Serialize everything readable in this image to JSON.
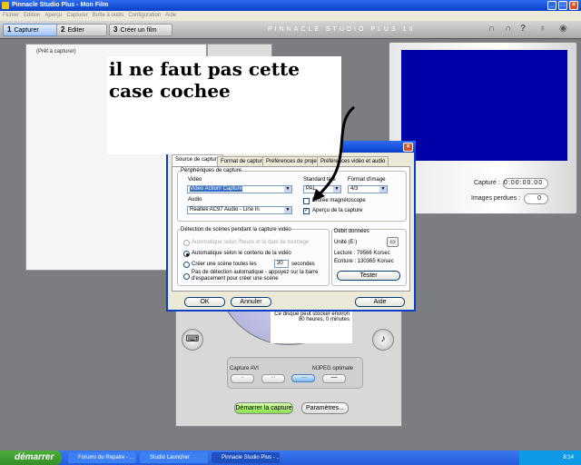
{
  "window": {
    "title": "Pinnacle Studio Plus - Mon Film"
  },
  "menu": [
    "Fichier",
    "Edition",
    "Aperçu",
    "Capturer",
    "Boîte à outils",
    "Configuration",
    "Aide"
  ],
  "tabs": [
    {
      "num": "1",
      "label": "Capturer"
    },
    {
      "num": "2",
      "label": "Editer"
    },
    {
      "num": "3",
      "label": "Créer un film"
    }
  ],
  "brand": "PINNACLE STUDIO PLUS 10",
  "album": {
    "status": "(Prêt à capturer)"
  },
  "preview": {
    "captured_label": "Capturé :",
    "captured_value": "0:00:00.00",
    "lost_label": "Images perdues :",
    "lost_value": "0"
  },
  "annotation": "il ne faut pas cette case cochee",
  "dialog": {
    "tabs": [
      "Source de capture",
      "Format de capture",
      "Préférences de projet",
      "Préférences vidéo et audio"
    ],
    "devices_group": "Périphériques de capture",
    "video_label": "Vidéo",
    "video_value": "Video Action! Capture",
    "audio_label": "Audio",
    "audio_value": "Realtek AC97 Audio - Line In",
    "tv_label": "Standard télé",
    "tv_value": "PAL",
    "format_label": "Format d'image",
    "format_value": "4/3",
    "vcr_label": "Entrée magnétoscope",
    "vcr_checked": false,
    "preview_label": "Aperçu de la capture",
    "preview_checked": true,
    "scene_group": "Détection de scènes pendant la capture vidéo",
    "scene_opt1": "Automatique selon l'heure et la date de tournage",
    "scene_opt2": "Automatique selon le contenu de la vidéo",
    "scene_opt3": "Créer une scène toutes les",
    "scene_seconds": "30",
    "seconds_label": "secondes",
    "scene_opt4": "Pas de détection automatique - appuyez sur la barre d'espacement pour créer une scène",
    "rate_group": "Débit données",
    "drive": "Unité (E:)",
    "read": "Lecture : 79566 Ko/sec",
    "write": "Ecriture : 130365 Ko/sec",
    "test": "Tester",
    "ok": "OK",
    "cancel": "Annuler",
    "help": "Aide"
  },
  "capture": {
    "disk_text1": "Ce disque peut stocker environ",
    "disk_text2": "80 heures, 0 minutes",
    "quality_left": "Capture AVI",
    "quality_right": "MJPEG optimale",
    "start": "Démarrer la capture",
    "params": "Paramètres..."
  },
  "taskbar": {
    "start": "démarrer",
    "tasks": [
      "Forums du Repaire - ...",
      "Studio Launcher",
      "Pinnacle Studio Plus - ..."
    ],
    "clock": "8:14"
  }
}
